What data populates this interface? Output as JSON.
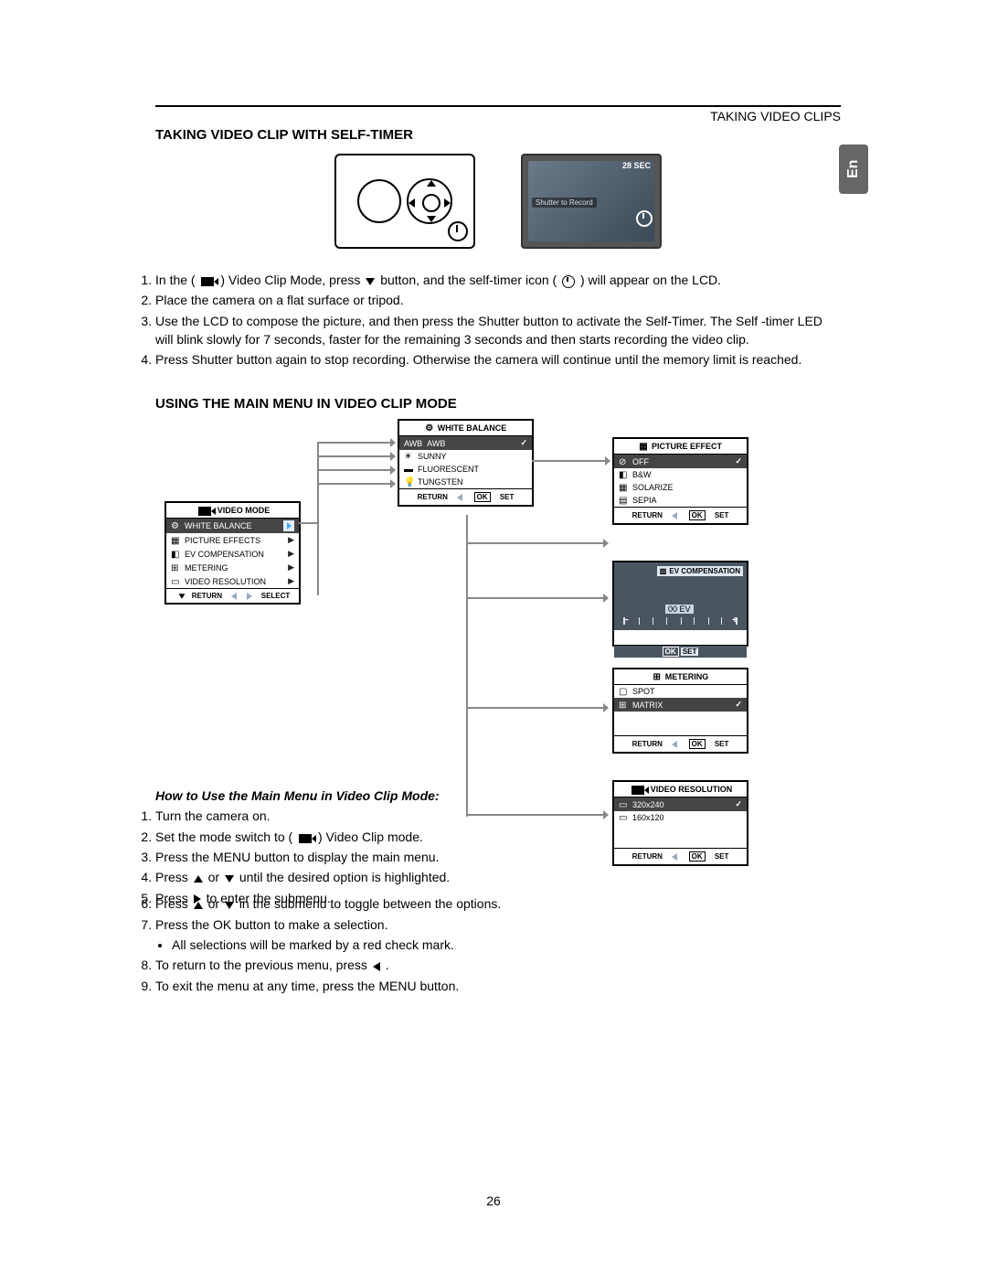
{
  "header": {
    "breadcrumb": "TAKING VIDEO CLIPS",
    "lang_tab": "En"
  },
  "section1": {
    "title": "TAKING VIDEO CLIP WITH SELF-TIMER",
    "lcd": {
      "seconds": "28 SEC",
      "record_hint": "Shutter to Record"
    },
    "steps": {
      "s1a": "In the (",
      "s1b": ") Video Clip Mode, press",
      "s1c": "button, and the self-timer icon (",
      "s1d": ") will appear on the LCD.",
      "s2": "Place the camera on a flat surface or tripod.",
      "s3": "Use the LCD to compose the picture, and then press the Shutter button to activate the Self-Timer. The Self -timer LED will blink slowly for 7 seconds, faster for the remaining 3 seconds and then starts recording the video clip.",
      "s4": "Press Shutter button again to stop recording. Otherwise the camera will continue until the memory limit is reached."
    }
  },
  "section2": {
    "title": "USING THE MAIN MENU IN VIDEO CLIP MODE",
    "main_menu": {
      "title": "VIDEO MODE",
      "items": [
        "WHITE BALANCE",
        "PICTURE EFFECTS",
        "EV COMPENSATION",
        "METERING",
        "VIDEO RESOLUTION"
      ],
      "footer_return": "RETURN",
      "footer_select": "SELECT"
    },
    "wb": {
      "title": "WHITE BALANCE",
      "items": [
        {
          "code": "AWB",
          "label": "AWB",
          "checked": true
        },
        {
          "code": "SUN",
          "label": "SUNNY"
        },
        {
          "code": "FL",
          "label": "FLUORESCENT"
        },
        {
          "code": "TG",
          "label": "TUNGSTEN"
        }
      ],
      "footer_return": "RETURN",
      "footer_set": "SET"
    },
    "pe": {
      "title": "PICTURE EFFECT",
      "items": [
        {
          "label": "OFF",
          "checked": true
        },
        {
          "label": "B&W"
        },
        {
          "label": "SOLARIZE"
        },
        {
          "label": "SEPIA"
        }
      ],
      "footer_return": "RETURN",
      "footer_set": "SET"
    },
    "ev": {
      "title": "EV COMPENSATION",
      "value": "00 EV",
      "footer_ok": "OK",
      "footer_set": "SET"
    },
    "metering": {
      "title": "METERING",
      "items": [
        {
          "label": "SPOT"
        },
        {
          "label": "MATRIX",
          "checked": true
        }
      ],
      "footer_return": "RETURN",
      "footer_set": "SET"
    },
    "res": {
      "title": "VIDEO RESOLUTION",
      "items": [
        {
          "label": "320x240",
          "checked": true
        },
        {
          "label": "160x120"
        }
      ],
      "footer_return": "RETURN",
      "footer_set": "SET"
    },
    "howto": {
      "heading": "How to Use the Main Menu in Video Clip Mode:",
      "s1": "Turn the camera on.",
      "s2a": "Set the mode switch to (",
      "s2b": ") Video Clip mode.",
      "s3": "Press the MENU button to display the main menu.",
      "s4a": "Press",
      "s4b": "or",
      "s4c": "until the desired option is highlighted.",
      "s5a": "Press",
      "s5b": "to enter the submenu.",
      "s6a": "Press",
      "s6b": "or",
      "s6c": "in the submenu to toggle between the options.",
      "s7": "Press the OK button to make a selection.",
      "s7_bullet": "All selections will be marked by a red check mark.",
      "s8a": "To return to the previous menu, press",
      "s8b": ".",
      "s9": "To exit the menu at any time, press the MENU button."
    }
  },
  "page_number": "26",
  "labels": {
    "ok": "OK"
  }
}
